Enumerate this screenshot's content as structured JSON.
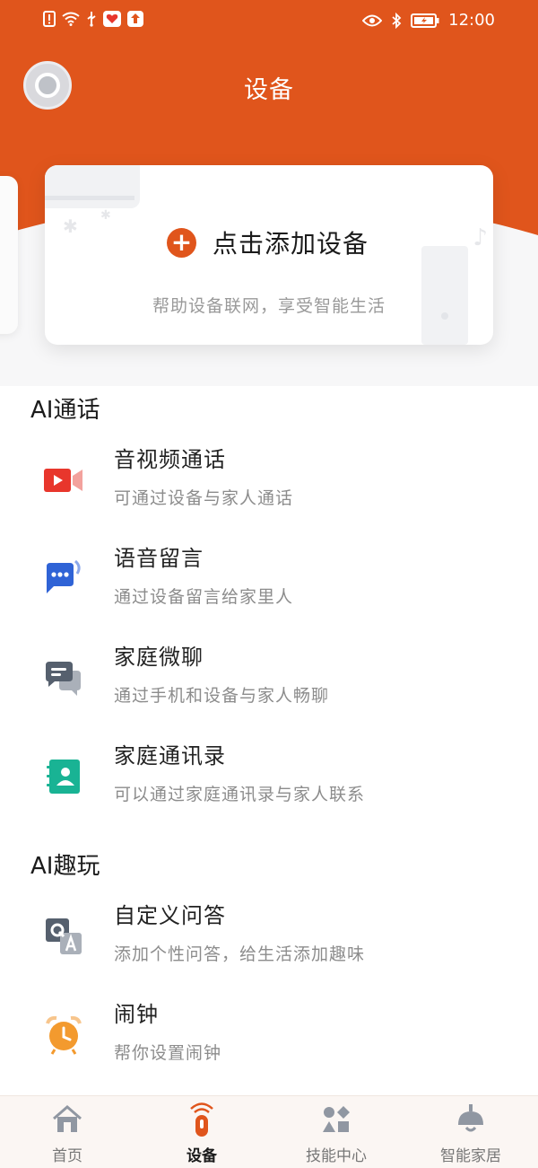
{
  "status": {
    "time": "12:00"
  },
  "header": {
    "title": "设备"
  },
  "add_card": {
    "label": "点击添加设备",
    "subtitle": "帮助设备联网，享受智能生活"
  },
  "sections": [
    {
      "title": "AI通话",
      "items": [
        {
          "title": "音视频通话",
          "subtitle": "可通过设备与家人通话",
          "icon": "video-call-icon"
        },
        {
          "title": "语音留言",
          "subtitle": "通过设备留言给家里人",
          "icon": "voice-message-icon"
        },
        {
          "title": "家庭微聊",
          "subtitle": "通过手机和设备与家人畅聊",
          "icon": "chat-icon"
        },
        {
          "title": "家庭通讯录",
          "subtitle": "可以通过家庭通讯录与家人联系",
          "icon": "contacts-icon"
        }
      ]
    },
    {
      "title": "AI趣玩",
      "items": [
        {
          "title": "自定义问答",
          "subtitle": "添加个性问答，给生活添加趣味",
          "icon": "qa-icon"
        },
        {
          "title": "闹钟",
          "subtitle": "帮你设置闹钟",
          "icon": "alarm-icon"
        }
      ]
    }
  ],
  "tabs": [
    {
      "label": "首页",
      "icon": "home-icon"
    },
    {
      "label": "设备",
      "icon": "remote-icon",
      "active": true
    },
    {
      "label": "技能中心",
      "icon": "shapes-icon"
    },
    {
      "label": "智能家居",
      "icon": "lamp-icon"
    }
  ],
  "colors": {
    "accent": "#e0551c",
    "red": "#e8362c",
    "blue": "#2f63d6",
    "slate": "#56606e",
    "teal": "#19b394",
    "orange": "#f39a2e"
  }
}
